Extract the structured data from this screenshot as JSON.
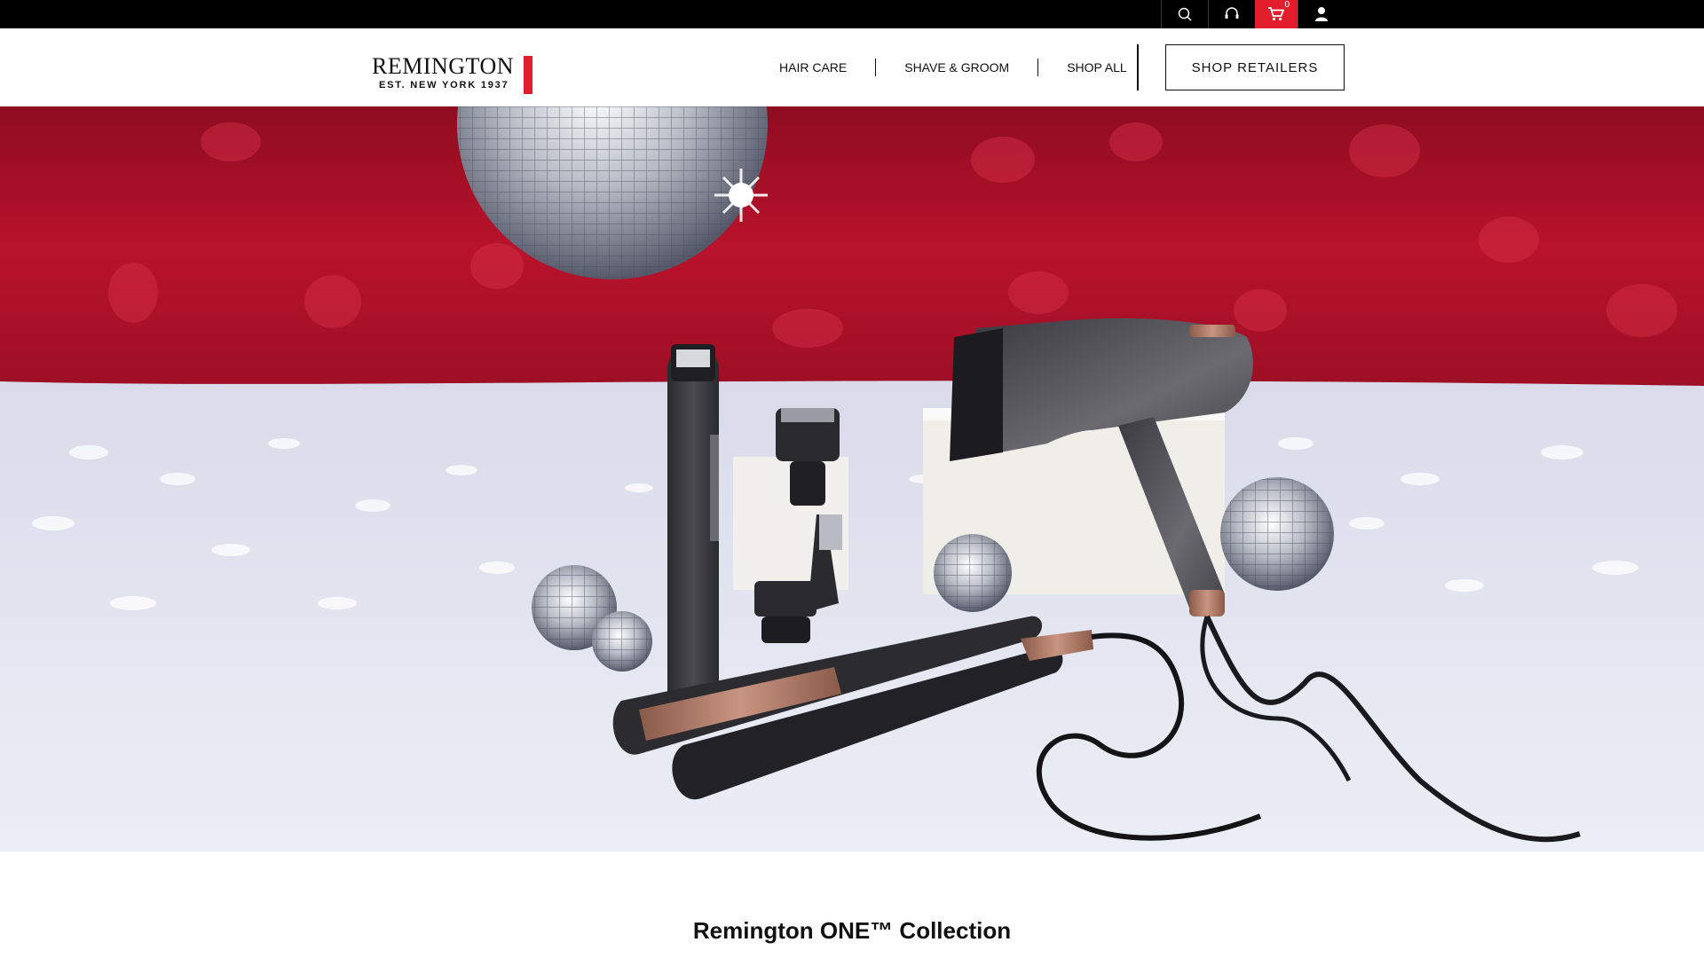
{
  "utility_bar": {
    "icons": [
      "search-icon",
      "support-icon",
      "cart-icon",
      "account-icon"
    ],
    "cart_count": "0",
    "colors": {
      "background": "#000000",
      "cart_accent": "#e21d2c"
    }
  },
  "header": {
    "logo": {
      "wordmark": "REMINGTON",
      "tagline": "EST. NEW YORK 1937"
    },
    "nav": [
      {
        "label": "HAIR CARE"
      },
      {
        "label": "SHAVE & GROOM"
      },
      {
        "label": "SHOP ALL"
      }
    ],
    "cta_label": "SHOP RETAILERS"
  },
  "hero": {
    "image": "Remington products with disco balls on red and white backdrop",
    "colors": {
      "backdrop": "#b0122a",
      "floor": "#e4e6f2"
    }
  },
  "section": {
    "title": "Remington ONE™ Collection"
  }
}
